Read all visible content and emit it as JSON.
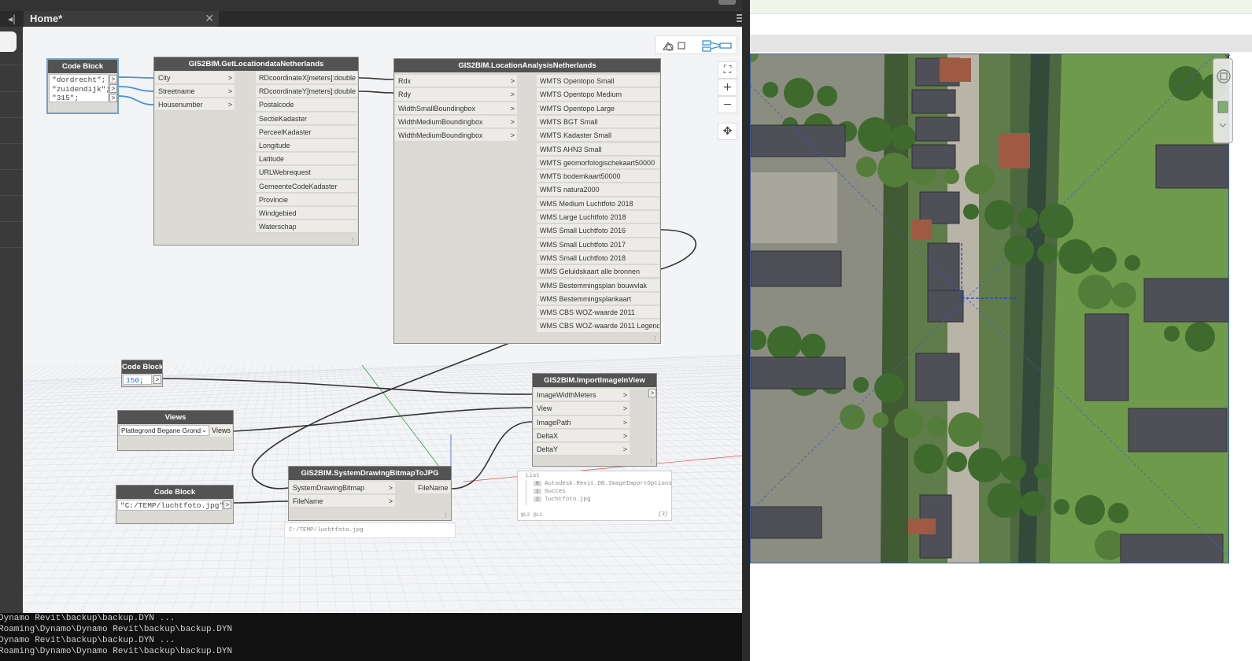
{
  "tab": {
    "title": "Home*",
    "close": "✕",
    "collapse": "◂|"
  },
  "nodes": {
    "codeblock1": {
      "title": "Code Block",
      "lines": [
        "\"dordrecht\";",
        "\"zuidendijk\";",
        "\"315\";"
      ]
    },
    "getlocation": {
      "title": "GIS2BIM.GetLocationdataNetherlands",
      "inputs": [
        "City",
        "Streetname",
        "Housenumber"
      ],
      "outputs": [
        "RDcoordinateX[meters]:double",
        "RDcoordinateY[meters]:double",
        "Postalcode",
        "SectieKadaster",
        "PerceelKadaster",
        "Longitude",
        "Latitude",
        "URLWebrequest",
        "GemeenteCodeKadaster",
        "Provincie",
        "Windgebied",
        "Waterschap"
      ]
    },
    "locationanalysis": {
      "title": "GIS2BIM.LocationAnalysisNetherlands",
      "inputs": [
        "Rdx",
        "Rdy",
        "WidthSmallBoundingbox",
        "WidthMediumBoundingbox",
        "WidthMediumBoundingbox"
      ],
      "outputs": [
        "WMTS Opentopo Small",
        "WMTS Opentopo Medium",
        "WMTS Opentopo Large",
        "WMTS BGT Small",
        "WMTS Kadaster Small",
        "WMTS AHN3 Small",
        "WMTS geomorfologischekaart50000",
        "WMTS bodemkaart50000",
        "WMTS natura2000",
        "WMS Medium Luchtfoto 2018",
        "WMS Large Luchtfoto 2018",
        "WMS Small Luchtfoto 2016",
        "WMS Small Luchtfoto 2017",
        "WMS Small Luchtfoto 2018",
        "WMS Geluidskaart alle bronnen",
        "WMS Bestemmingsplan bouwvlak",
        "WMS Bestemmingsplankaart",
        "WMS CBS WOZ-waarde 2011",
        "WMS CBS WOZ-waarde 2011 Legenda"
      ]
    },
    "codeblock2": {
      "title": "Code Block",
      "value": "150",
      "suffix": ";"
    },
    "views": {
      "title": "Views",
      "selected": "Plattegrond Begane Grond",
      "output": "Views"
    },
    "codeblock3": {
      "title": "Code Block",
      "value": "\"C:/TEMP/luchtfoto.jpg\";"
    },
    "bitmap": {
      "title": "GIS2BIM.SystemDrawingBitmapToJPG",
      "inputs": [
        "SystemDrawingBitmap",
        "FileName"
      ],
      "outputs": [
        "FileName"
      ]
    },
    "importimage": {
      "title": "GIS2BIM.ImportImageInView",
      "inputs": [
        "ImageWidthMeters",
        "View",
        "ImagePath",
        "DeltaX",
        "DeltaY"
      ]
    }
  },
  "watch": {
    "header": "List",
    "items": [
      {
        "index": "0",
        "value": "Autodesk.Revit.DB.ImageImportOptions"
      },
      {
        "index": "1",
        "value": "Succes"
      },
      {
        "index": "2",
        "value": "luchtfoto.jpg"
      }
    ],
    "footer_left": "@L2 @L1",
    "count": "{3}"
  },
  "path_preview": "C:/TEMP/luchtfoto.jpg",
  "console": [
    "Dynamo Revit\\backup\\backup.DYN ...",
    "Roaming\\Dynamo\\Dynamo Revit\\backup\\backup.DYN",
    "Dynamo Revit\\backup\\backup.DYN ...",
    "Roaming\\Dynamo\\Dynamo Revit\\backup\\backup.DYN"
  ],
  "colors": {
    "wire": "#333333",
    "selected_wire": "#4a90d9",
    "node_header": "#535353",
    "canvas": "#f3f4f6"
  }
}
